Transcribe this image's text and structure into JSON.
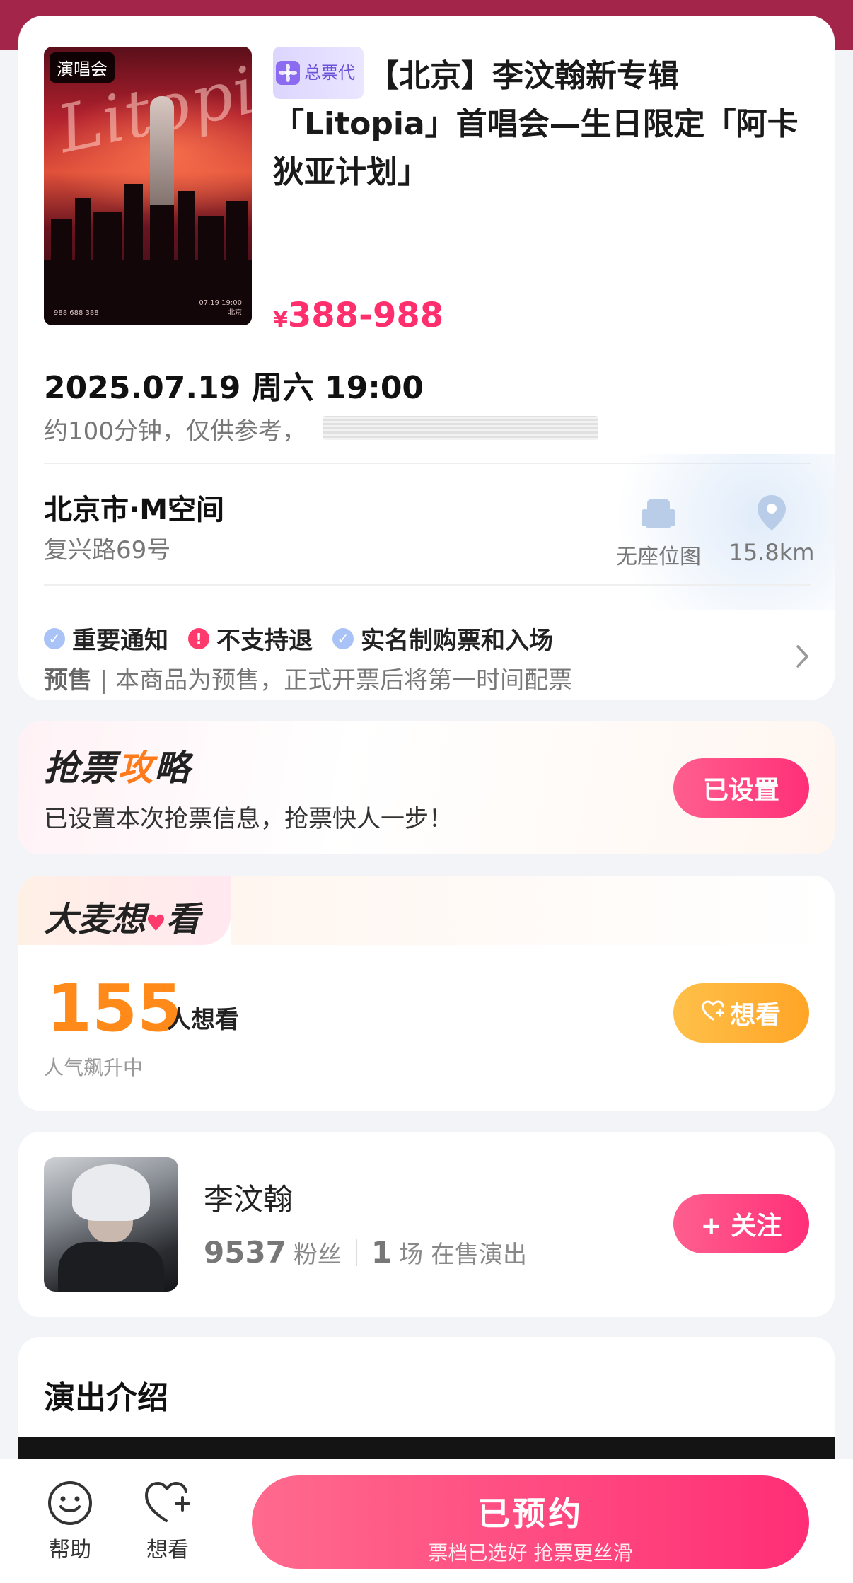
{
  "event": {
    "poster_tag": "演唱会",
    "agent_badge": "总票代",
    "title": "【北京】李汶翰新专辑「Litopia」首唱会—生日限定「阿卡狄亚计划」",
    "price_symbol": "¥",
    "price_range": "388-988",
    "poster_script": "Litopia",
    "poster_small_date": "07.19 19:00",
    "poster_small_city": "北京",
    "poster_small_price": "988 688 388"
  },
  "session": {
    "datetime": "2025.07.19 周六 19:00",
    "duration": "约100分钟，仅供参考，"
  },
  "venue": {
    "name": "北京市·M空间",
    "address": "复兴路69号",
    "seat_label": "无座位图",
    "distance": "15.8km"
  },
  "notices": {
    "items": [
      {
        "label": "重要通知",
        "type": "check"
      },
      {
        "label": "不支持退",
        "type": "alert"
      },
      {
        "label": "实名制购票和入场",
        "type": "check"
      }
    ],
    "presale_label": "预售",
    "presale_text": " | 本商品为预售，正式开票后将第一时间配票"
  },
  "strategy": {
    "title_a": "抢票",
    "title_b": "攻",
    "title_c": "略",
    "description": "已设置本次抢票信息，抢票快人一步！",
    "button": "已设置"
  },
  "want": {
    "title_a": "大麦",
    "title_b": "想",
    "title_c": "看",
    "count": "155",
    "unit": "人想看",
    "sub": "人气飙升中",
    "button": "想看"
  },
  "artist": {
    "name": "李汶翰",
    "fans": "9537",
    "fans_unit": "粉丝",
    "shows": "1",
    "shows_unit": "场 在售演出",
    "follow_button": "+ 关注"
  },
  "intro": {
    "title": "演出介绍"
  },
  "bottom": {
    "help": "帮助",
    "want": "想看",
    "main_button": "已预约",
    "main_sub": "票档已选好 抢票更丝滑"
  },
  "colors": {
    "accent_pink": "#ff2f78",
    "price_pink": "#ff2f6e",
    "want_orange": "#ff8a1a",
    "top_band": "#a3264a"
  }
}
